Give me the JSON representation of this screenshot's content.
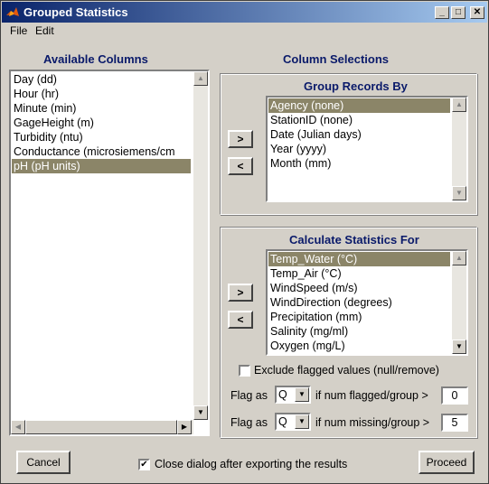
{
  "window": {
    "title": "Grouped Statistics"
  },
  "menu": {
    "items": [
      "File",
      "Edit"
    ]
  },
  "available": {
    "heading": "Available Columns",
    "items": [
      "Day (dd)",
      "Hour (hr)",
      "Minute (min)",
      "GageHeight (m)",
      "Turbidity (ntu)",
      "Conductance (microsiemens/cm",
      "pH (pH units)"
    ],
    "selected": "pH (pH units)"
  },
  "column_selections": {
    "heading": "Column Selections"
  },
  "group_by": {
    "heading": "Group Records By",
    "items": [
      "Agency (none)",
      "StationID (none)",
      "Date (Julian days)",
      "Year (yyyy)",
      "Month (mm)"
    ],
    "selected": "Agency (none)",
    "add_label": ">",
    "remove_label": "<"
  },
  "stats_for": {
    "heading": "Calculate Statistics For",
    "items": [
      "Temp_Water (°C)",
      "Temp_Air (°C)",
      "WindSpeed (m/s)",
      "WindDirection (degrees)",
      "Precipitation (mm)",
      "Salinity (mg/ml)",
      "Oxygen (mg/L)"
    ],
    "selected": "Temp_Water (°C)",
    "add_label": ">",
    "remove_label": "<"
  },
  "exclude_flagged": {
    "label": "Exclude flagged values (null/remove)",
    "checked": false
  },
  "flag_rows": [
    {
      "prefix": "Flag as",
      "value": "Q",
      "suffix": "if num flagged/group >",
      "threshold": "0"
    },
    {
      "prefix": "Flag as",
      "value": "Q",
      "suffix": "if num missing/group >",
      "threshold": "5"
    }
  ],
  "footer": {
    "cancel_label": "Cancel",
    "close_dialog_label": "Close dialog after exporting the results",
    "close_dialog_checked": true,
    "proceed_label": "Proceed"
  },
  "glyphs": {
    "check": "✔",
    "up": "▲",
    "down": "▼",
    "left": "◀",
    "right": "▶",
    "min": "_",
    "max": "□",
    "close": "✕"
  },
  "colors": {
    "selection": "#8b8568",
    "heading": "#0a1a6a",
    "titlebar_start": "#0a246a",
    "titlebar_end": "#a6caf0"
  }
}
